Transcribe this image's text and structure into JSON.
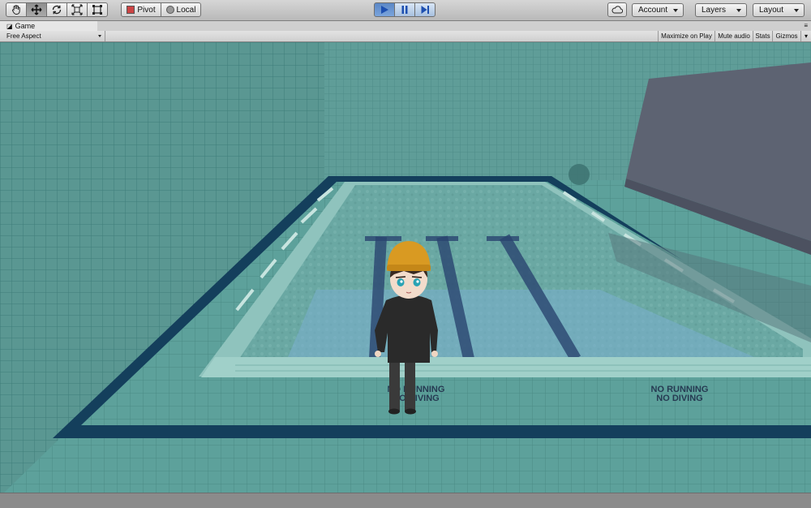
{
  "toolbar": {
    "tools": [
      {
        "name": "hand-tool",
        "icon": "hand-icon"
      },
      {
        "name": "move-tool",
        "icon": "move-arrows-icon"
      },
      {
        "name": "rotate-tool",
        "icon": "rotate-icon"
      },
      {
        "name": "scale-tool",
        "icon": "scale-icon"
      },
      {
        "name": "rect-tool",
        "icon": "rect-icon"
      }
    ],
    "pivot_label": "Pivot",
    "local_label": "Local",
    "play_controls": {
      "play": "play-icon",
      "pause": "pause-icon",
      "step": "step-icon"
    },
    "cloud_icon": "cloud-icon",
    "account_label": "Account",
    "layers_label": "Layers",
    "layout_label": "Layout"
  },
  "game_tab": {
    "title": "Game",
    "aspect": "Free Aspect",
    "buttons": [
      "Maximize on Play",
      "Mute audio",
      "Stats",
      "Gizmos"
    ]
  },
  "scene": {
    "signs": [
      "NO RUNNING",
      "NO DIVING"
    ],
    "colors": {
      "tile": "#5f9c97",
      "pool_water": "#6fa8a4",
      "lane_stripe": "#27416a",
      "border_dark": "#123f5a",
      "gray_block": "#5d6372",
      "character_hat": "#d99a22",
      "character_hoodie": "#2a2a2a"
    }
  }
}
